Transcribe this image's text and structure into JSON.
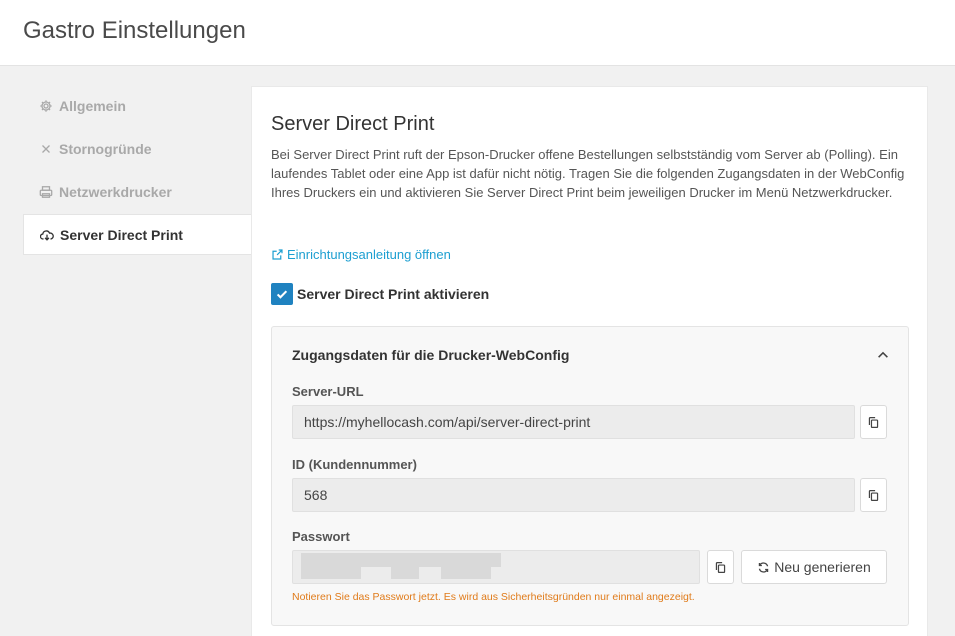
{
  "header": {
    "title": "Gastro Einstellungen"
  },
  "sidebar": {
    "items": [
      {
        "label": "Allgemein",
        "icon": "gear-icon",
        "active": false
      },
      {
        "label": "Stornogründe",
        "icon": "close-icon",
        "active": false
      },
      {
        "label": "Netzwerkdrucker",
        "icon": "printer-icon",
        "active": false
      },
      {
        "label": "Server Direct Print",
        "icon": "cloud-download-icon",
        "active": true
      }
    ]
  },
  "main": {
    "title": "Server Direct Print",
    "description": "Bei Server Direct Print ruft der Epson-Drucker offene Bestellungen selbstständig vom Server ab (Polling). Ein laufendes Tablet oder eine App ist dafür nicht nötig. Tragen Sie die folgenden Zugangsdaten in der WebConfig Ihres Druckers ein und aktivieren Sie Server Direct Print beim jeweiligen Drucker im Menü Netzwerkdrucker.",
    "guide_link": "Einrichtungsanleitung öffnen",
    "activate_label": "Server Direct Print aktivieren",
    "activate_checked": true,
    "credentials": {
      "title": "Zugangsdaten für die Drucker-WebConfig",
      "expanded": true,
      "server_url_label": "Server-URL",
      "server_url_value": "https://myhellocash.com/api/server-direct-print",
      "id_label": "ID (Kundennummer)",
      "id_value": "568",
      "password_label": "Passwort",
      "password_hidden": true,
      "regenerate_label": "Neu generieren",
      "hint": "Notieren Sie das Passwort jetzt. Es wird aus Sicherheitsgründen nur einmal angezeigt."
    }
  },
  "colors": {
    "accent": "#1f82c0",
    "link": "#1d9fd1",
    "warning": "#e07b1a"
  }
}
